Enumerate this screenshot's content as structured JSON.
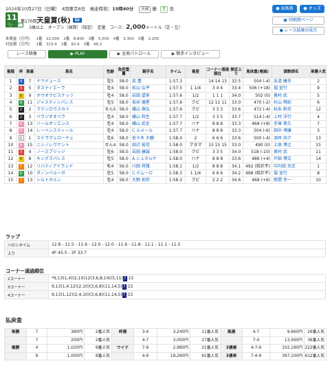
{
  "header": {
    "date_line": "2024年10月27日（日曜）　4回東京8日　発走時刻：",
    "post_time": "15時40分",
    "weather_label": "天候",
    "weather": "曇",
    "surface": "芝",
    "going": "良"
  },
  "race": {
    "number": "11",
    "number_suffix": "R",
    "course_badge": [
      "コース",
      "5"
    ],
    "kai": "第170回",
    "name": "天皇賞(秋)",
    "grade": "GⅠ",
    "conditions": "3歳以上　オープン（国際）（指定）　定量　コース：",
    "distance": "2,000",
    "distance_note": "メートル（芝・左）"
  },
  "prize": {
    "row1_label": "本賞金（万円）",
    "row1": [
      "1着　22,000",
      "2着　8,800",
      "3着　5,500",
      "4着　3,300",
      "5着　2,200"
    ],
    "row2_label": "付加賞（万円）",
    "row2": [
      "1着　323.4",
      "2着　92.4",
      "3着　46.2"
    ]
  },
  "buttons": {
    "horse_list": "出馬表",
    "odds": "オッズ",
    "print": "印刷用ページ",
    "result_guide": "レース結果の見方"
  },
  "tabs": {
    "video": "レース映像",
    "play": "PLAY",
    "patrol": "全周パトロール",
    "interview": "騎手インタビュー"
  },
  "results_headers": [
    "着順",
    "枠",
    "馬番",
    "馬名",
    "性齢",
    "負担重量",
    "騎手名",
    "タイム",
    "着差",
    "コーナー通過順位",
    "推定上り",
    "馬体重(増減)",
    "調教師名",
    "単勝人気"
  ],
  "results": [
    [
      "1",
      "4",
      "7",
      "ドウデュース",
      "牡5",
      "58.0",
      "武 豊",
      "1:57.3",
      "",
      "14 14 13",
      "32.5",
      "504 (-4)",
      "友道 康夫",
      "2"
    ],
    [
      "2",
      "3",
      "5",
      "タスティエーラ",
      "牡4",
      "58.0",
      "松山 弘平",
      "1:57.5",
      "1 1/4",
      "3 4 4",
      "33.4",
      "506 (+18)",
      "堀 宣行",
      "9"
    ],
    [
      "3",
      "5",
      "9",
      "ホウオウビスケッツ",
      "牡4",
      "58.0",
      "岩田 望来",
      "1:57.6",
      "1/2",
      "1 1 1",
      "34.0",
      "502 (0)",
      "奥村 武",
      "5"
    ],
    [
      "4",
      "6",
      "11",
      "ジャスティンパレス",
      "牡5",
      "58.0",
      "坂井 瑠星",
      "1:57.6",
      "クビ",
      "12 11 11",
      "33.0",
      "470 (-2)",
      "杉山 晴紀",
      "6"
    ],
    [
      "5",
      "2",
      "2",
      "マテンロウスカイ",
      "せん5",
      "58.0",
      "横山 典弘",
      "1:57.6",
      "クビ",
      "3 3 3",
      "33.6",
      "472 (-4)",
      "松永 幹夫",
      "12"
    ],
    [
      "6",
      "2",
      "3",
      "ベラジオオペラ",
      "牡4",
      "58.0",
      "横山 和生",
      "1:57.7",
      "1/2",
      "3 3 5",
      "33.7",
      "514 (-4)",
      "上村 洋行",
      "4"
    ],
    [
      "7",
      "8",
      "13",
      "ソールオリエンス",
      "牡4",
      "58.0",
      "横山 武史",
      "1:57.7",
      "ハナ",
      "8 8 8",
      "33.3",
      "468 (+8)",
      "手塚 貴久",
      "7"
    ],
    [
      "8",
      "8",
      "14",
      "レーベンスティール",
      "牡4",
      "58.0",
      "C.ルメール",
      "1:57.7",
      "ハナ",
      "8 8 8",
      "33.3",
      "504 (-6)",
      "田中 博康",
      "3"
    ],
    [
      "9",
      "1",
      "1",
      "ステラヴェローチェ",
      "牡6",
      "58.0",
      "佐々木 大輔",
      "1:58.0",
      "2",
      "6 6 6",
      "33.6",
      "500 (-4)",
      "須貝 尚介",
      "13"
    ],
    [
      "10",
      "8",
      "15",
      "ニシノレヴナント",
      "せん4",
      "58.0",
      "田辺 裕信",
      "1:58.0",
      "アタマ",
      "15 15 15",
      "33.0",
      "490 (0)",
      "上原 博之",
      "15"
    ],
    [
      "11",
      "3",
      "4",
      "ノースブリッジ",
      "牡6",
      "58.0",
      "岩田 康誠",
      "1:58.0",
      "クビ",
      "3 3 5",
      "34.0",
      "518 (-10)",
      "奥村 武",
      "11"
    ],
    [
      "12",
      "5",
      "8",
      "キングズパレス",
      "牡5",
      "58.0",
      "A.シュタルケ",
      "1:58.0",
      "ハナ",
      "8 8 8",
      "33.6",
      "486 (+4)",
      "戸田 博文",
      "14"
    ],
    [
      "13",
      "7",
      "12",
      "リバティアイランド",
      "牝4",
      "56.0",
      "川田 将雅",
      "1:58.1",
      "1/2",
      "8 8 8",
      "34.1",
      "492 (前計不)",
      "中内田 充正",
      "1"
    ],
    [
      "14",
      "6",
      "10",
      "ダノンベルーガ",
      "牡5",
      "58.0",
      "C.デムーロ",
      "1:58.3",
      "1 1/4",
      "6 6 6",
      "34.2",
      "498 (前計不)",
      "堀 宣行",
      "8"
    ],
    [
      "15",
      "7",
      "13",
      "シルトホルン",
      "牡4",
      "58.0",
      "大野 拓弥",
      "1:58.3",
      "クビ",
      "2 2 2",
      "34.6",
      "468 (+6)",
      "新開 幸一",
      "10"
    ]
  ],
  "waku_colors": [
    "#ffffff",
    "#222222",
    "#e53935",
    "#1e63c8",
    "#f2c200",
    "#2e9e45",
    "#f57c00",
    "#f48fb1"
  ],
  "laps": {
    "section_title": "ラップ",
    "halon_label": "ハロンタイム",
    "halon": "12.8 - 11.5 - 11.6 - 12.0 - 12.0 - 11.9 - 11.8 - 11.1 - 11.1 - 11.5",
    "agari_label": "上り",
    "agari": "4F 45.5 - 3F 33.7"
  },
  "corners": {
    "section_title": "コーナー通過順位",
    "rows": [
      {
        "label": "2コーナー",
        "before": "*9,13(1,4)(2,10)12(3,6,8,14)(5,11)",
        "hl": "7",
        "after": "-15"
      },
      {
        "label": "3コーナー",
        "before": "9,13(1,4,12)(2,10)(3,6,8)(11,14,5)",
        "hl": "7",
        "after": "-15"
      },
      {
        "label": "4コーナー",
        "before": "9,13(1,12)(2,4,10)(3,6,8)(11,14,5)",
        "hl": "7",
        "after": "-15"
      }
    ]
  },
  "payouts": {
    "section_title": "払戻金",
    "rows": [
      [
        "単勝",
        "7",
        "380円",
        "2番人気",
        "枠連",
        "3-4",
        "3,240円",
        "11番人気",
        "馬連",
        "4-7",
        "9,660円",
        "26番人気"
      ],
      [
        "",
        "7",
        "200円",
        "2番人気",
        "",
        "4-7",
        "3,000円",
        "27番人気",
        "",
        "7-4",
        "13,560円",
        "36番人気"
      ],
      [
        "複勝",
        "4",
        "1,020円",
        "9番人気",
        "ワイド",
        "7-9",
        "2,980円",
        "21番人気",
        "3連複",
        "4-7-9",
        "102,180円",
        "222番人気"
      ],
      [
        "",
        "9",
        "1,000円",
        "8番人気",
        "",
        "4-9",
        "18,280円",
        "61番人気",
        "3連単",
        "7-4-9",
        "397,100円",
        "612番人気"
      ]
    ]
  }
}
